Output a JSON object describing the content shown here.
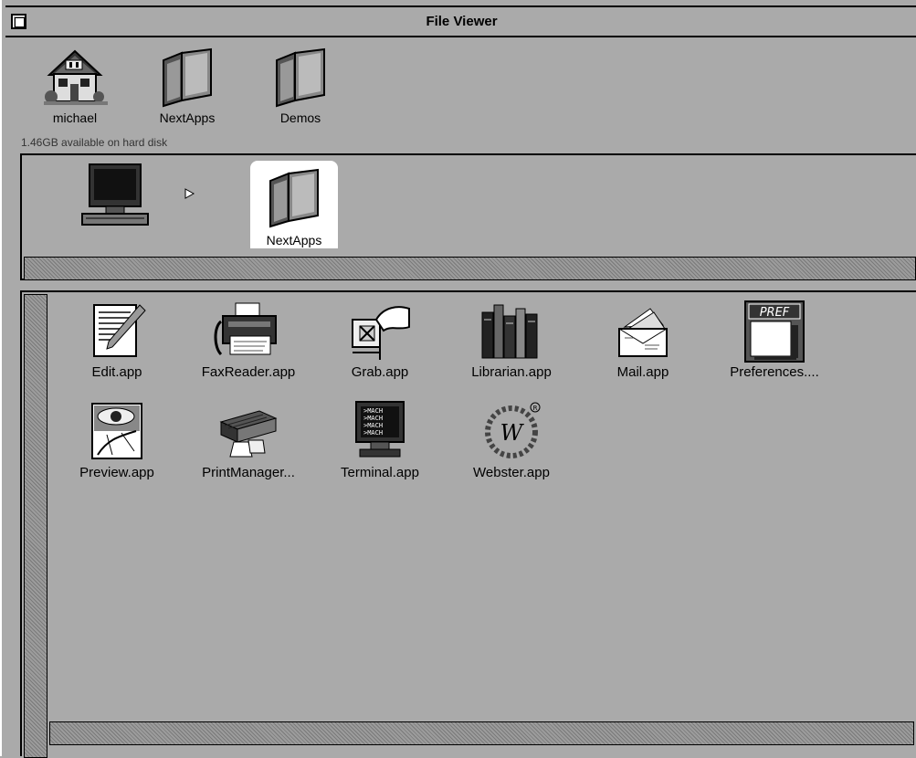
{
  "window": {
    "title": "File Viewer"
  },
  "shelf": {
    "items": [
      {
        "label": "michael",
        "icon": "house-icon"
      },
      {
        "label": "NextApps",
        "icon": "folder-icon"
      },
      {
        "label": "Demos",
        "icon": "folder-icon"
      }
    ],
    "disk_info": "1.46GB available on hard disk"
  },
  "browser": {
    "path": [
      {
        "label": "",
        "icon": "computer-icon"
      },
      {
        "label": "NextApps",
        "icon": "folder-icon"
      }
    ]
  },
  "apps": [
    {
      "label": "Edit.app",
      "icon": "edit-icon"
    },
    {
      "label": "FaxReader.app",
      "icon": "fax-icon"
    },
    {
      "label": "Grab.app",
      "icon": "grab-icon"
    },
    {
      "label": "Librarian.app",
      "icon": "books-icon"
    },
    {
      "label": "Mail.app",
      "icon": "mail-icon"
    },
    {
      "label": "Preferences....",
      "icon": "preferences-icon"
    },
    {
      "label": "Preview.app",
      "icon": "preview-icon"
    },
    {
      "label": "PrintManager...",
      "icon": "printer-icon"
    },
    {
      "label": "Terminal.app",
      "icon": "terminal-icon"
    },
    {
      "label": "Webster.app",
      "icon": "webster-icon"
    }
  ],
  "colors": {
    "background": "#aaaaaa",
    "selection": "#ffffff",
    "text": "#000000"
  }
}
